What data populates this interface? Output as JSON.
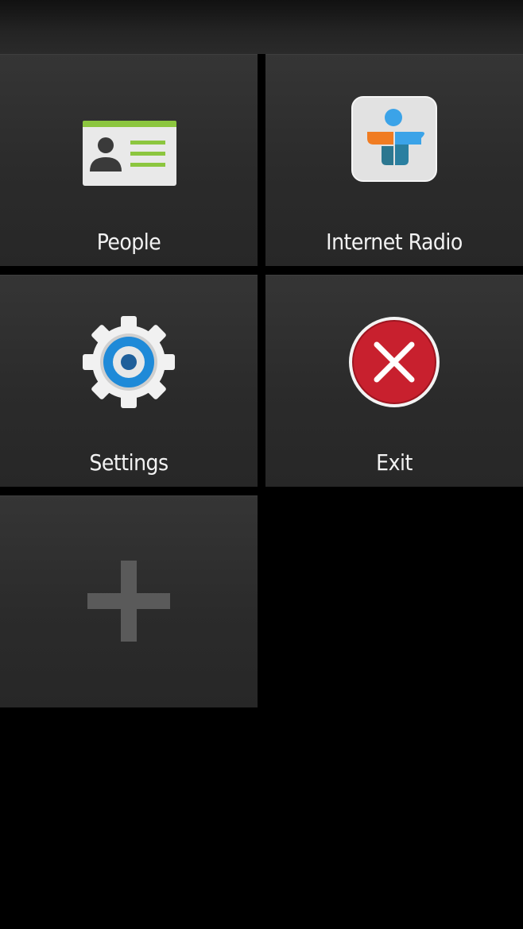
{
  "tiles": {
    "people": {
      "label": "People",
      "icon": "contact-card-icon"
    },
    "internet_radio": {
      "label": "Internet Radio",
      "icon": "tunein-radio-icon"
    },
    "settings": {
      "label": "Settings",
      "icon": "gear-icon"
    },
    "exit": {
      "label": "Exit",
      "icon": "close-icon"
    },
    "add": {
      "icon": "plus-icon"
    }
  },
  "colors": {
    "background": "#000000",
    "tile": "#2e2e2e",
    "accent_green": "#8cc63f",
    "settings_blue": "#1f8ad8",
    "exit_red": "#c8202e"
  }
}
